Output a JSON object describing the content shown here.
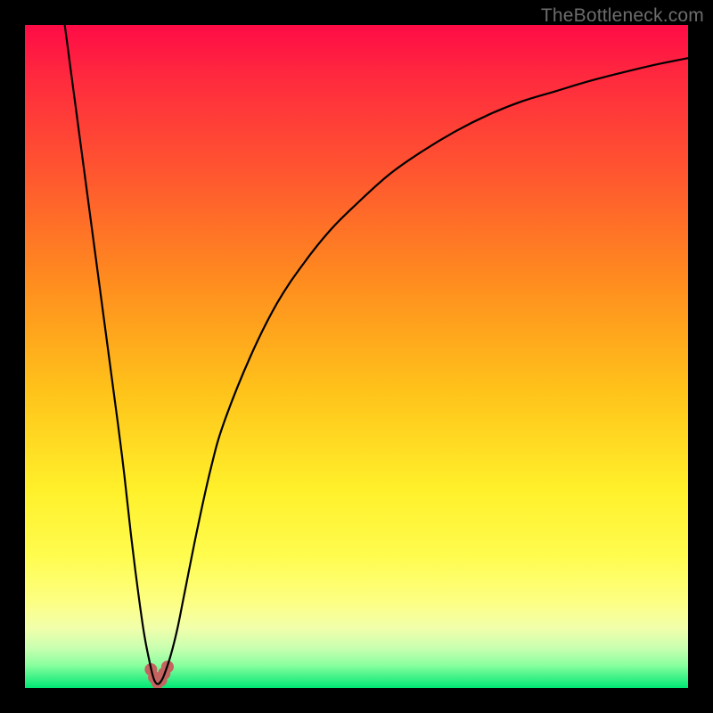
{
  "watermark": "TheBottleneck.com",
  "colors": {
    "frame": "#000000",
    "curve": "#000000",
    "marker": "#c4635f",
    "gradient_stops": [
      "#ff0b46",
      "#ff2a3e",
      "#ff5530",
      "#ff8a1f",
      "#ffc21a",
      "#fff02a",
      "#fffc4e",
      "#fdff83",
      "#f1ffab",
      "#c8ffb0",
      "#8bff9f",
      "#00e774"
    ]
  },
  "chart_data": {
    "type": "line",
    "title": "",
    "xlabel": "",
    "ylabel": "",
    "xlim": [
      0,
      100
    ],
    "ylim": [
      0,
      100
    ],
    "grid": false,
    "legend": false,
    "x": [
      6,
      8,
      10,
      12,
      14,
      15,
      16,
      17,
      18,
      19,
      19.5,
      20,
      20.5,
      21,
      22,
      23,
      24,
      26,
      28,
      30,
      34,
      38,
      42,
      46,
      50,
      55,
      60,
      65,
      70,
      75,
      80,
      85,
      90,
      95,
      100
    ],
    "values": [
      100,
      85,
      70,
      55,
      40,
      32,
      23,
      15,
      8,
      3,
      1.2,
      0.6,
      1.0,
      2,
      5,
      9,
      14,
      24,
      33,
      40,
      50,
      58,
      64,
      69,
      73,
      77.5,
      81,
      84,
      86.5,
      88.5,
      90,
      91.5,
      92.8,
      94,
      95
    ],
    "markers": {
      "x": [
        19,
        19.5,
        20,
        20.5,
        21,
        21.5
      ],
      "y": [
        2.8,
        1.6,
        0.8,
        1.2,
        2.2,
        3.2
      ]
    }
  }
}
